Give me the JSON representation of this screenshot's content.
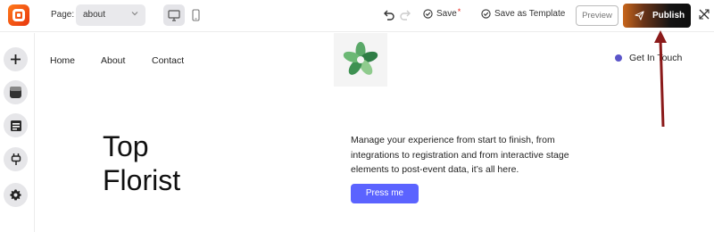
{
  "toolbar": {
    "page_label": "Page:",
    "page_value": "about",
    "save_label": "Save",
    "save_unsaved_marker": "*",
    "save_template_label": "Save as Template",
    "preview_label": "Preview",
    "publish_label": "Publish",
    "icons": {
      "logo": "app-logo-icon",
      "chevron": "chevron-down-icon",
      "desktop": "desktop-icon",
      "mobile": "mobile-icon",
      "undo": "undo-icon",
      "redo": "redo-icon",
      "save": "check-circle-icon",
      "publish": "paper-plane-icon",
      "close": "collapse-icon"
    }
  },
  "rail": {
    "items": [
      {
        "name": "add-element",
        "icon": "plus-icon"
      },
      {
        "name": "sections",
        "icon": "layout-icon"
      },
      {
        "name": "templates",
        "icon": "article-icon"
      },
      {
        "name": "integrations",
        "icon": "plug-icon"
      },
      {
        "name": "settings",
        "icon": "gear-icon"
      }
    ]
  },
  "site": {
    "nav": [
      "Home",
      "About",
      "Contact"
    ],
    "cta_label": "Get In Touch",
    "hero_title_line1": "Top",
    "hero_title_line2": "Florist",
    "hero_copy": "Manage your experience from start to finish, from integrations to registration and from interactive stage elements to post-event data, it’s all here.",
    "button_label": "Press me",
    "brand_icon": "flower-logo-icon"
  },
  "colors": {
    "accent": "#5b63ff",
    "bullet": "#5b55c9",
    "arrow": "#8b1a1a",
    "publish_gradient_start": "#c8661b",
    "publish_gradient_end": "#0e0e0e"
  }
}
